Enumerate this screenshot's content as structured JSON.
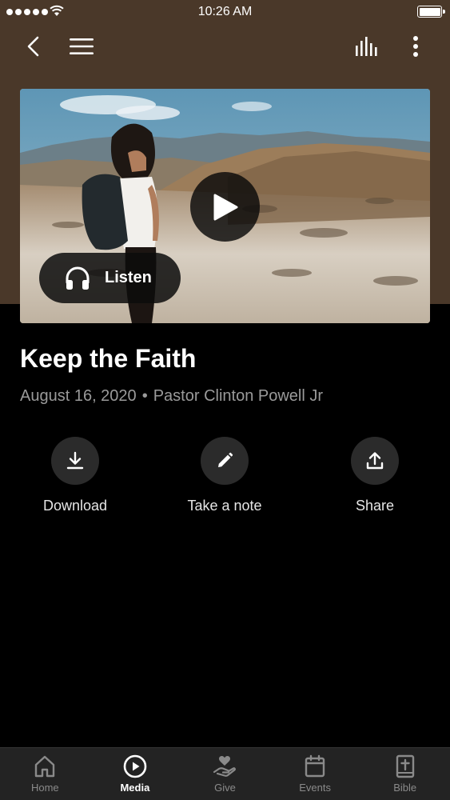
{
  "status_bar": {
    "time": "10:26 AM"
  },
  "nav": {
    "back_icon": "chevron-left-icon",
    "menu_icon": "hamburger-menu-icon",
    "equalizer_icon": "audio-equalizer-icon",
    "more_icon": "more-vertical-icon"
  },
  "hero": {
    "play_icon": "play-icon",
    "listen_label": "Listen"
  },
  "sermon": {
    "title": "Keep the Faith",
    "date": "August 16, 2020",
    "separator": "•",
    "speaker": "Pastor Clinton Powell Jr"
  },
  "actions": [
    {
      "label": "Download",
      "icon": "download-icon"
    },
    {
      "label": "Take a note",
      "icon": "pencil-icon"
    },
    {
      "label": "Share",
      "icon": "share-icon"
    }
  ],
  "tabs": [
    {
      "label": "Home",
      "icon": "home-icon",
      "active": false
    },
    {
      "label": "Media",
      "icon": "play-circle-icon",
      "active": true
    },
    {
      "label": "Give",
      "icon": "give-hand-heart-icon",
      "active": false
    },
    {
      "label": "Events",
      "icon": "calendar-icon",
      "active": false
    },
    {
      "label": "Bible",
      "icon": "bible-icon",
      "active": false
    }
  ],
  "colors": {
    "header_brown": "#4a3829",
    "background": "#000000",
    "tab_bar": "#232323",
    "muted_text": "#9a9a9a"
  }
}
